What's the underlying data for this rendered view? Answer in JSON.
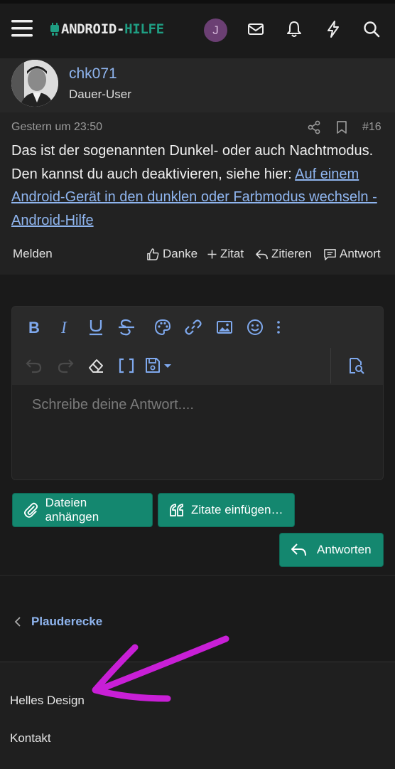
{
  "header": {
    "logo_part1": "ANDROID-",
    "logo_part2": "HILFE",
    "user_initial": "J"
  },
  "post": {
    "username": "chk071",
    "user_title": "Dauer-User",
    "date": "Gestern um 23:50",
    "number": "#16",
    "text_before_link": "Das ist der sogenannten Dunkel- oder auch Nachtmodus. Den kannst du auch deaktivieren, siehe hier: ",
    "link_text": "Auf einem Android-Gerät in den dunklen oder Farbmodus wechseln - Android-Hilfe",
    "actions": {
      "report": "Melden",
      "like": "Danke",
      "quote_add": "Zitat",
      "quote": "Zitieren",
      "reply": "Antwort"
    }
  },
  "editor": {
    "placeholder": "Schreibe deine Antwort...."
  },
  "buttons": {
    "attach": "Dateien anhängen",
    "insert_quotes": "Zitate einfügen…",
    "submit": "Antworten"
  },
  "breadcrumb": {
    "label": "Plauderecke"
  },
  "footer": {
    "light_design": "Helles Design",
    "contact": "Kontakt"
  },
  "colors": {
    "accent": "#14876f",
    "link": "#8fb5ef",
    "annotation_arrow": "#c81fd6"
  }
}
